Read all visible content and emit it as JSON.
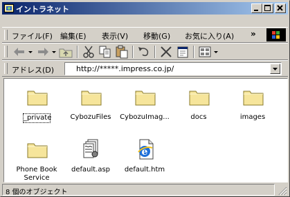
{
  "window": {
    "title": "イントラネット",
    "app_icon": "folder-web-icon",
    "buttons": [
      "minimize-icon",
      "maximize-icon",
      "close-icon"
    ]
  },
  "menu": {
    "items": [
      "ファイル(F)",
      "編集(E)",
      "表示(V)",
      "移動(G)",
      "お気に入り(A)"
    ],
    "overflow": "»"
  },
  "toolbar": {
    "icons": [
      "back-icon",
      "forward-icon",
      "up-folder-icon",
      "cut-icon",
      "copy-icon",
      "paste-icon",
      "undo-icon",
      "delete-icon",
      "properties-icon",
      "views-icon"
    ]
  },
  "address": {
    "label": "アドレス(D)",
    "value": "http://*****.impress.co.jp/"
  },
  "files": [
    {
      "name": "_private",
      "icon": "folder-icon",
      "selected": true
    },
    {
      "name": "CybozuFiles",
      "icon": "folder-icon"
    },
    {
      "name": "CybozuImag...",
      "icon": "folder-icon"
    },
    {
      "name": "docs",
      "icon": "folder-icon"
    },
    {
      "name": "images",
      "icon": "folder-icon"
    },
    {
      "name": "Phone Book Service",
      "icon": "folder-icon"
    },
    {
      "name": "default.asp",
      "icon": "asp-file-icon"
    },
    {
      "name": "default.htm",
      "icon": "html-file-icon"
    }
  ],
  "status": {
    "text": "8 個のオブジェクト"
  },
  "colors": {
    "title_start": "#0a246a",
    "title_end": "#a6caf0",
    "face": "#d4d0c8",
    "folder": "#f6e59b"
  }
}
